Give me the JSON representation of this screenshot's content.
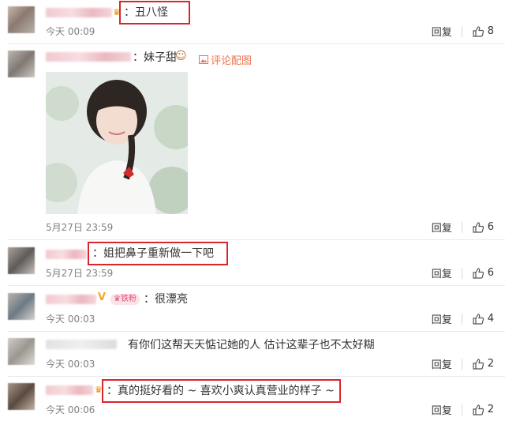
{
  "comments": [
    {
      "text": "：丑八怪",
      "time": "今天 00:09",
      "reply": "回复",
      "likes": "8"
    },
    {
      "text": "：妹子甜",
      "pic_link": "评论配图",
      "time": "5月27日 23:59",
      "reply": "回复",
      "likes": "6"
    },
    {
      "text": "：姐把鼻子重新做一下吧",
      "time": "5月27日 23:59",
      "reply": "回复",
      "likes": "6"
    },
    {
      "text": "：很漂亮",
      "badge": "铁粉",
      "time": "今天 00:03",
      "reply": "回复",
      "likes": "4"
    },
    {
      "text": "有你们这帮天天惦记她的人 估计这辈子也不太好糊",
      "time": "今天 00:03",
      "reply": "回复",
      "likes": "2"
    },
    {
      "text": "：真的挺好看的 ~ 喜欢小爽认真营业的样子 ~",
      "time": "今天 00:06",
      "reply": "回复",
      "likes": "2"
    }
  ],
  "colors": {
    "highlight": "#d9262b",
    "link": "#eb7350",
    "meta": "#808080"
  },
  "icons": [
    "thumbs-up-icon",
    "image-icon",
    "crown-icon",
    "verified-v-icon"
  ]
}
